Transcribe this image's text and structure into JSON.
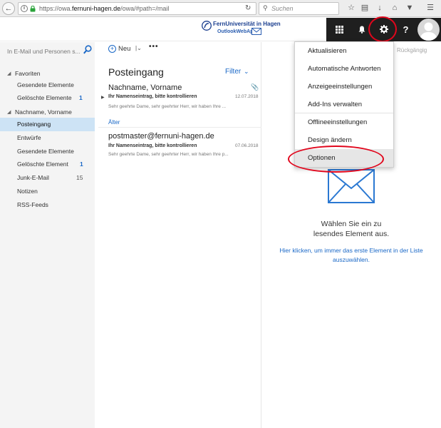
{
  "browser": {
    "url_prefix": "https://owa.",
    "url_domain": "fernuni-hagen.de",
    "url_rest": "/owa/#path=/mail",
    "search_placeholder": "Suchen"
  },
  "header": {
    "logo_title": "FernUniversität in Hagen",
    "logo_sub": "OutlookWebApp",
    "apps_icon": "grid-icon",
    "notification_icon": "bell-icon",
    "settings_icon": "gear-icon",
    "help_label": "?"
  },
  "leftnav": {
    "search_placeholder": "In E-Mail und Personen s...",
    "groups": [
      {
        "label": "Favoriten",
        "items": [
          {
            "label": "Gesendete Elemente",
            "count": ""
          },
          {
            "label": "Gelöschte Elemente",
            "count": "1"
          }
        ]
      },
      {
        "label": "Nachname, Vorname",
        "items": [
          {
            "label": "Posteingang",
            "count": "",
            "selected": true
          },
          {
            "label": "Entwürfe",
            "count": ""
          },
          {
            "label": "Gesendete Elemente",
            "count": ""
          },
          {
            "label": "Gelöschte Element",
            "count": "1"
          },
          {
            "label": "Junk-E-Mail",
            "count": "15"
          },
          {
            "label": "Notizen",
            "count": ""
          },
          {
            "label": "RSS-Feeds",
            "count": ""
          }
        ]
      }
    ]
  },
  "list": {
    "new_label": "Neu",
    "more_label": "•••",
    "folder_title": "Posteingang",
    "filter_label": "Filter",
    "messages": [
      {
        "from": "Nachname, Vorname",
        "subject": "Ihr Namenseintrag, bitte kontrollieren",
        "preview": "Sehr geehrte Dame, sehr geehrter Herr,   wir haben Ihre ...",
        "date": "12.07.2018"
      },
      {
        "from": "postmaster@fernuni-hagen.de",
        "subject": "Ihr Namenseintrag, bitte kontrollieren",
        "preview": "Sehr geehrte Dame, sehr geehrter Herr,   wir haben Ihre p...",
        "date": "07.06.2018"
      }
    ],
    "older_label": "Älter"
  },
  "reading": {
    "undo_label": "Rückgängig",
    "empty_title": "Wählen Sie ein zu lesendes Element aus.",
    "empty_link": "Hier klicken, um immer das erste Element in der Liste auszuwählen."
  },
  "menu": {
    "items": [
      "Aktualisieren",
      "Automatische Antworten",
      "Anzeigeeinstellungen",
      "Add-Ins verwalten",
      "Offlineeinstellungen",
      "Design ändern",
      "Optionen"
    ],
    "highlighted_index": 6
  },
  "colors": {
    "accent": "#1a68c7",
    "header_buttons": "#1f1f1f",
    "selection": "#cde3f5",
    "annotation_red": "#e1061c"
  }
}
